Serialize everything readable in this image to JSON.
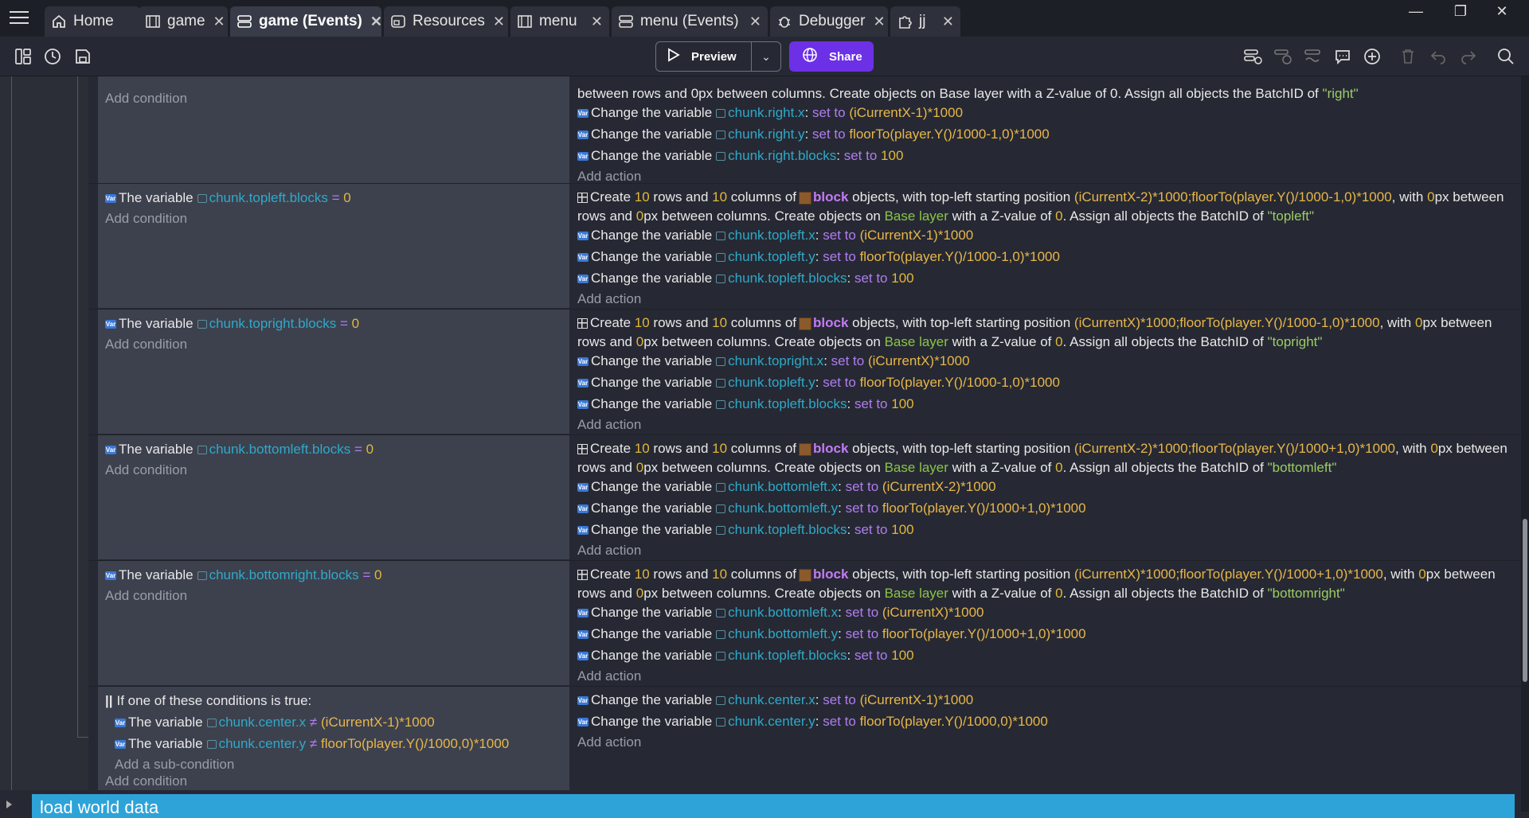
{
  "tabs": [
    {
      "label": "Home",
      "icon": "home-icon",
      "active": false
    },
    {
      "label": "game",
      "icon": "scene-icon",
      "active": false
    },
    {
      "label": "game (Events)",
      "icon": "events-icon",
      "active": true
    },
    {
      "label": "Resources",
      "icon": "resources-icon",
      "active": false
    },
    {
      "label": "menu",
      "icon": "scene-icon",
      "active": false
    },
    {
      "label": "menu (Events)",
      "icon": "events-icon",
      "active": false
    },
    {
      "label": "Debugger",
      "icon": "debugger-icon",
      "active": false
    },
    {
      "label": "jj",
      "icon": "extension-icon",
      "active": false
    }
  ],
  "toolbar": {
    "preview_label": "Preview",
    "share_label": "Share"
  },
  "events": [
    {
      "conditions": [],
      "add_condition": "Add condition",
      "create_tail": "between rows and 0px between columns. Create objects on Base layer with a Z-value of 0. Assign all objects the BatchID of",
      "batch_id": "\"right\"",
      "actions": [
        {
          "var": "chunk.right.x",
          "value": "(iCurrentX-1)*1000"
        },
        {
          "var": "chunk.right.y",
          "value": "floorTo(player.Y()/1000-1,0)*1000"
        },
        {
          "var": "chunk.right.blocks",
          "value": "100"
        }
      ],
      "add_action": "Add action"
    },
    {
      "conditions": [
        {
          "var": "chunk.topleft.blocks",
          "cmp": "=",
          "value": "0"
        }
      ],
      "add_condition": "Add condition",
      "create": {
        "rows": "10",
        "cols": "10",
        "object": "block",
        "pos": "(iCurrentX-2)*1000;floorTo(player.Y()/1000-1,0)*1000",
        "spacing": "0",
        "layer": "Base layer",
        "z": "0",
        "batch": "\"topleft\""
      },
      "actions": [
        {
          "var": "chunk.topleft.x",
          "value": "(iCurrentX-1)*1000"
        },
        {
          "var": "chunk.topleft.y",
          "value": "floorTo(player.Y()/1000-1,0)*1000"
        },
        {
          "var": "chunk.topleft.blocks",
          "value": "100"
        }
      ],
      "add_action": "Add action"
    },
    {
      "conditions": [
        {
          "var": "chunk.topright.blocks",
          "cmp": "=",
          "value": "0"
        }
      ],
      "add_condition": "Add condition",
      "create": {
        "rows": "10",
        "cols": "10",
        "object": "block",
        "pos": "(iCurrentX)*1000;floorTo(player.Y()/1000-1,0)*1000",
        "spacing": "0",
        "layer": "Base layer",
        "z": "0",
        "batch": "\"topright\""
      },
      "actions": [
        {
          "var": "chunk.topright.x",
          "value": "(iCurrentX)*1000"
        },
        {
          "var": "chunk.topleft.y",
          "value": "floorTo(player.Y()/1000-1,0)*1000"
        },
        {
          "var": "chunk.topleft.blocks",
          "value": "100"
        }
      ],
      "add_action": "Add action"
    },
    {
      "conditions": [
        {
          "var": "chunk.bottomleft.blocks",
          "cmp": "=",
          "value": "0"
        }
      ],
      "add_condition": "Add condition",
      "create": {
        "rows": "10",
        "cols": "10",
        "object": "block",
        "pos": "(iCurrentX-2)*1000;floorTo(player.Y()/1000+1,0)*1000",
        "spacing": "0",
        "layer": "Base layer",
        "z": "0",
        "batch": "\"bottomleft\""
      },
      "actions": [
        {
          "var": "chunk.bottomleft.x",
          "value": "(iCurrentX-2)*1000"
        },
        {
          "var": "chunk.bottomleft.y",
          "value": "floorTo(player.Y()/1000+1,0)*1000"
        },
        {
          "var": "chunk.topleft.blocks",
          "value": "100"
        }
      ],
      "add_action": "Add action"
    },
    {
      "conditions": [
        {
          "var": "chunk.bottomright.blocks",
          "cmp": "=",
          "value": "0"
        }
      ],
      "add_condition": "Add condition",
      "create": {
        "rows": "10",
        "cols": "10",
        "object": "block",
        "pos": "(iCurrentX)*1000;floorTo(player.Y()/1000+1,0)*1000",
        "spacing": "0",
        "layer": "Base layer",
        "z": "0",
        "batch": "\"bottomright\""
      },
      "actions": [
        {
          "var": "chunk.bottomleft.x",
          "value": "(iCurrentX)*1000"
        },
        {
          "var": "chunk.bottomleft.y",
          "value": "floorTo(player.Y()/1000+1,0)*1000"
        },
        {
          "var": "chunk.topleft.blocks",
          "value": "100"
        }
      ],
      "add_action": "Add action"
    },
    {
      "or_title": "If one of these conditions is true:",
      "sub_conditions": [
        {
          "var": "chunk.center.x",
          "cmp": "≠",
          "value": "(iCurrentX-1)*1000"
        },
        {
          "var": "chunk.center.y",
          "cmp": "≠",
          "value": "floorTo(player.Y()/1000,0)*1000"
        }
      ],
      "add_sub_condition": "Add a sub-condition",
      "add_condition": "Add condition",
      "actions": [
        {
          "var": "chunk.center.x",
          "value": "(iCurrentX-1)*1000"
        },
        {
          "var": "chunk.center.y",
          "value": "floorTo(player.Y()/1000,0)*1000"
        }
      ],
      "add_action": "Add action"
    }
  ],
  "strings": {
    "the_variable": "The variable",
    "change_the_variable": "Change the variable",
    "set_to": "set to",
    "create": "Create",
    "rows_and": "rows and",
    "columns_of": "columns of",
    "objects_pos": "objects, with top-left starting position",
    "with": "with",
    "px_between_rows": "px between rows and",
    "px_between_cols": "px between columns. Create objects on",
    "with_z": "with a Z-value of",
    "assign": ". Assign all objects the BatchID of"
  },
  "bottom_group": {
    "label": "load world data"
  }
}
